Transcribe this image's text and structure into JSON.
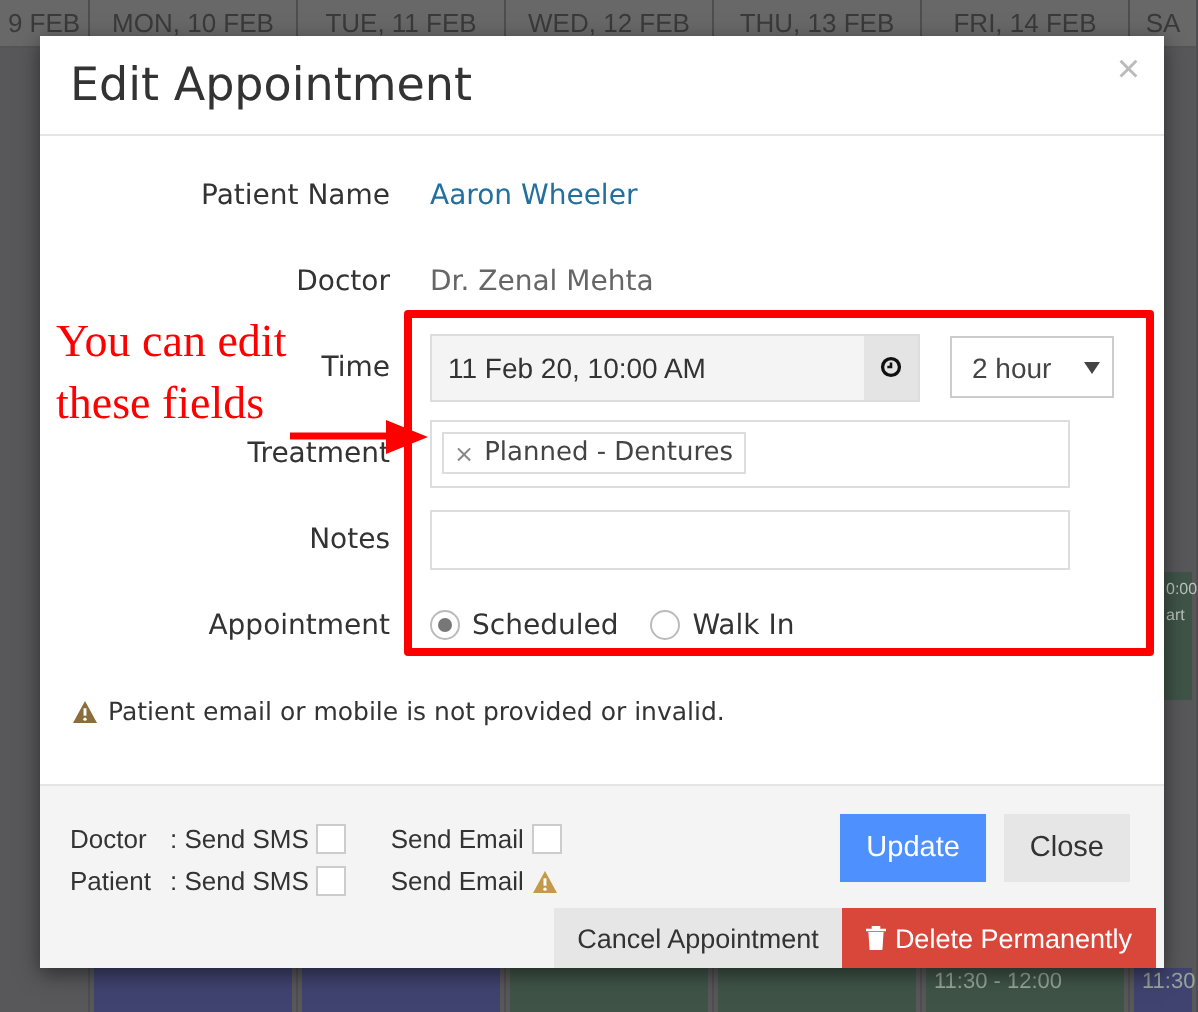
{
  "calendar": {
    "days": [
      {
        "label": "9 FEB"
      },
      {
        "label": "MON, 10 FEB",
        "events": [
          {
            "kind": "lower",
            "color": "#404370"
          }
        ]
      },
      {
        "label": "TUE, 11 FEB",
        "events": [
          {
            "kind": "lower",
            "color": "#404370"
          }
        ]
      },
      {
        "label": "WED, 12 FEB",
        "events": [
          {
            "kind": "lower",
            "color": "#3f5447"
          }
        ]
      },
      {
        "label": "THU, 13 FEB",
        "events": [
          {
            "kind": "lower",
            "color": "#3f5447"
          }
        ]
      },
      {
        "label": "FRI, 14 FEB",
        "events": [
          {
            "kind": "lower",
            "color": "#3f5447",
            "time": "11:30 - 12:00"
          }
        ]
      },
      {
        "label": "SA",
        "events": [
          {
            "kind": "upper",
            "color": "#3f5447",
            "time": "0:00",
            "title": "art"
          },
          {
            "kind": "lower",
            "color": "#404370",
            "time": "11:30"
          }
        ]
      }
    ]
  },
  "modal": {
    "title": "Edit Appointment",
    "close": "×",
    "patient": {
      "label": "Patient Name",
      "value": "Aaron Wheeler"
    },
    "doctor": {
      "label": "Doctor",
      "value": "Dr. Zenal Mehta"
    },
    "time": {
      "label": "Time",
      "value": "11 Feb 20, 10:00 AM",
      "duration": "2 hour"
    },
    "treatment": {
      "label": "Treatment",
      "tags": [
        {
          "remove": "×",
          "text": "Planned - Dentures"
        }
      ]
    },
    "notes": {
      "label": "Notes"
    },
    "appointment": {
      "label": "Appointment",
      "options": [
        {
          "label": "Scheduled",
          "selected": true
        },
        {
          "label": "Walk In",
          "selected": false
        }
      ]
    },
    "warning": "Patient email or mobile is not provided or invalid.",
    "notify": [
      {
        "who": "Doctor",
        "sms": ": Send SMS",
        "sms_checked": false,
        "email": {
          "label": "Send Email",
          "kind": "checkbox",
          "checked": false
        }
      },
      {
        "who": "Patient",
        "sms": ": Send SMS",
        "sms_checked": false,
        "email": {
          "label": "Send Email",
          "kind": "warning"
        }
      }
    ],
    "update": "Update",
    "close_button": "Close",
    "cancel": "Cancel Appointment",
    "delete": "Delete Permanently"
  },
  "annotation": {
    "text": "You can edit these fields"
  }
}
